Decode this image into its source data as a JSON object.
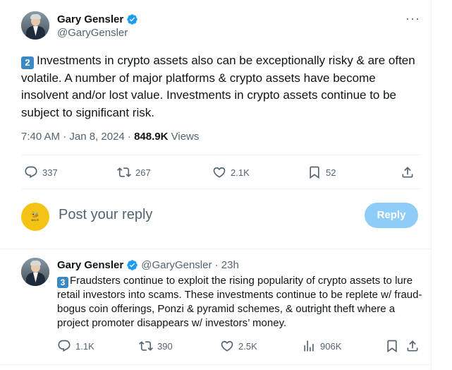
{
  "main_tweet": {
    "author_name": "Gary Gensler",
    "author_handle": "@GaryGensler",
    "number_badge": "2",
    "text": "Investments in crypto assets also can be exceptionally risky & are often volatile. A number of major platforms & crypto assets have become insolvent and/or lost value. Investments in crypto assets continue to be subject to significant risk.",
    "time": "7:40 AM · Jan 8, 2024 · ",
    "views_count": "848.9K",
    "views_label": " Views",
    "more_label": "···",
    "actions": {
      "replies": "337",
      "retweets": "267",
      "likes": "2.1K",
      "bookmarks": "52"
    }
  },
  "reply_box": {
    "avatar_logo": "🐝",
    "avatar_text": "BNVE",
    "placeholder": "Post your reply",
    "button_label": "Reply"
  },
  "reply_tweet": {
    "author_name": "Gary Gensler",
    "meta": "@GaryGensler · 23h",
    "number_badge": "3",
    "text": "Fraudsters continue to exploit the rising popularity of crypto assets to lure retail investors into scams. These investments continue to be replete w/ fraud- bogus coin offerings, Ponzi & pyramid schemes, & outright theft where a project promoter disappears w/ investors’ money.",
    "actions": {
      "replies": "1.1K",
      "retweets": "390",
      "likes": "2.5K",
      "views": "906K"
    }
  },
  "colors": {
    "text": "#0f1419",
    "muted": "#536471",
    "accent": "#1d9bf0",
    "reply_button": "#8ecdf7",
    "badge": "#3b88c3"
  }
}
